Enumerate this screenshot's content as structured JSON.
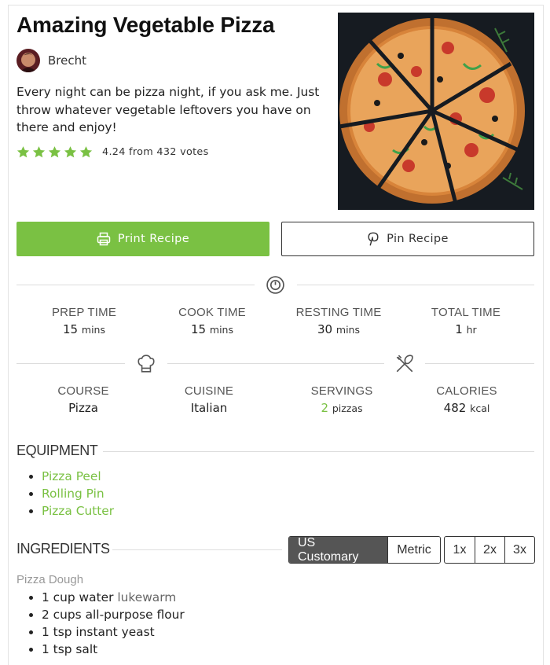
{
  "recipe": {
    "title": "Amazing Vegetable Pizza",
    "author": "Brecht",
    "summary": "Every night can be pizza night, if you ask me. Just throw whatever vegetable leftovers you have on there and enjoy!",
    "rating": {
      "stars": 5,
      "text": "4.24 from 432 votes"
    },
    "image_icon": "pizza-photo"
  },
  "buttons": {
    "print": "Print Recipe",
    "pin": "Pin Recipe"
  },
  "times": [
    {
      "label": "PREP TIME",
      "value": "15",
      "unit": "mins"
    },
    {
      "label": "COOK TIME",
      "value": "15",
      "unit": "mins"
    },
    {
      "label": "RESTING TIME",
      "value": "30",
      "unit": "mins"
    },
    {
      "label": "TOTAL TIME",
      "value": "1",
      "unit": "hr"
    }
  ],
  "meta": [
    {
      "label": "COURSE",
      "value": "Pizza"
    },
    {
      "label": "CUISINE",
      "value": "Italian"
    },
    {
      "label": "SERVINGS",
      "value": "2",
      "unit": "pizzas"
    },
    {
      "label": "CALORIES",
      "value": "482",
      "unit": "kcal"
    }
  ],
  "equipment": {
    "heading": "EQUIPMENT",
    "items": [
      "Pizza Peel",
      "Rolling Pin",
      "Pizza Cutter"
    ]
  },
  "ingredients": {
    "heading": "INGREDIENTS",
    "unit_options": [
      "US Customary",
      "Metric"
    ],
    "unit_selected": "US Customary",
    "scale_options": [
      "1x",
      "2x",
      "3x"
    ],
    "group": "Pizza Dough",
    "items": [
      {
        "text": "1 cup water",
        "note": "lukewarm"
      },
      {
        "text": "2 cups all-purpose flour",
        "note": ""
      },
      {
        "text": "1 tsp instant yeast",
        "note": ""
      },
      {
        "text": "1 tsp salt",
        "note": ""
      }
    ]
  },
  "colors": {
    "accent": "#7ac143",
    "dark_toggle": "#555555"
  }
}
